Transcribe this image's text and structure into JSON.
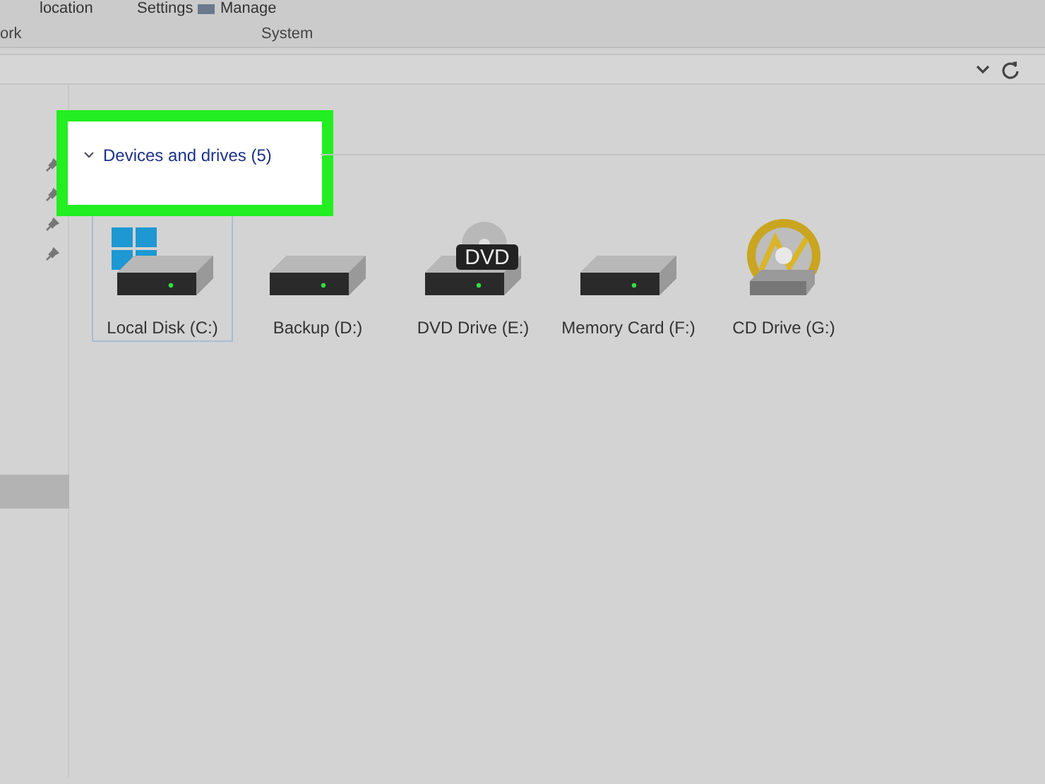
{
  "ribbon": {
    "commands": [
      {
        "label": "location",
        "kind": "text"
      },
      {
        "label": "Settings",
        "kind": "text"
      },
      {
        "label": "Manage",
        "kind": "icon-text"
      }
    ],
    "groups": [
      "ork",
      "System"
    ]
  },
  "section": {
    "title": "Devices and drives (5)",
    "expanded": true,
    "highlighted": true
  },
  "drives": [
    {
      "label": "Local Disk (C:)",
      "kind": "system",
      "selected": true
    },
    {
      "label": "Backup (D:)",
      "kind": "disk",
      "selected": false
    },
    {
      "label": "DVD Drive (E:)",
      "kind": "dvd",
      "badge": "DVD",
      "selected": false
    },
    {
      "label": "Memory Card (F:)",
      "kind": "disk",
      "selected": false
    },
    {
      "label": "CD Drive (G:)",
      "kind": "cd",
      "selected": false
    }
  ]
}
